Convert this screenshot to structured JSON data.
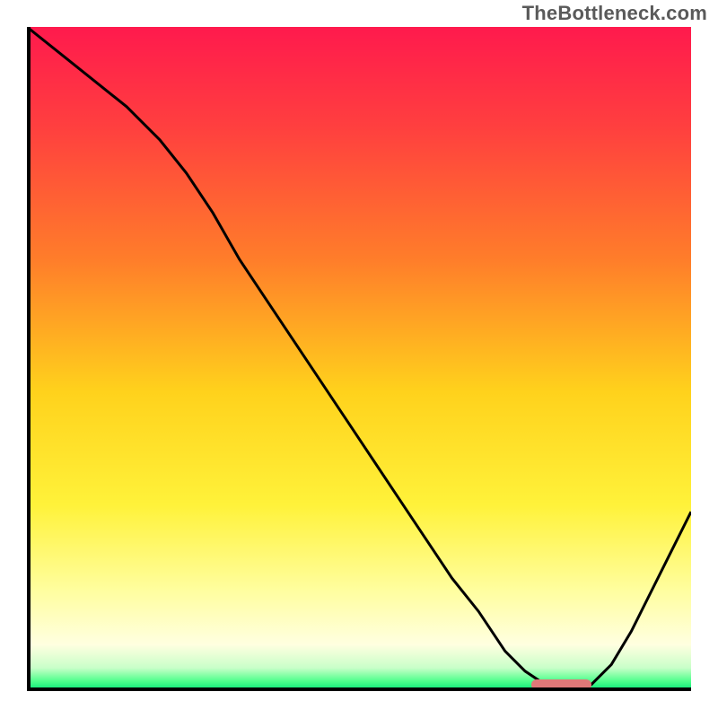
{
  "watermark": {
    "text": "TheBottleneck.com"
  },
  "chart_data": {
    "type": "line",
    "title": "",
    "xlabel": "",
    "ylabel": "",
    "xlim": [
      0,
      100
    ],
    "ylim": [
      0,
      100
    ],
    "grid": false,
    "legend": false,
    "background": {
      "type": "vertical_gradient",
      "stops": [
        {
          "pos": 0.0,
          "color": "#ff1a4d"
        },
        {
          "pos": 0.15,
          "color": "#ff3f3f"
        },
        {
          "pos": 0.35,
          "color": "#ff7d2a"
        },
        {
          "pos": 0.55,
          "color": "#ffd21c"
        },
        {
          "pos": 0.72,
          "color": "#fff23a"
        },
        {
          "pos": 0.85,
          "color": "#fffea0"
        },
        {
          "pos": 0.93,
          "color": "#ffffe0"
        },
        {
          "pos": 0.965,
          "color": "#c9ffc9"
        },
        {
          "pos": 0.985,
          "color": "#4fff8c"
        },
        {
          "pos": 1.0,
          "color": "#00e676"
        }
      ]
    },
    "series": [
      {
        "name": "bottleneck-curve",
        "color": "#000000",
        "x": [
          0,
          5,
          10,
          15,
          20,
          24,
          28,
          32,
          36,
          40,
          44,
          48,
          52,
          56,
          60,
          64,
          68,
          72,
          75,
          78,
          82,
          85,
          88,
          91,
          94,
          97,
          100
        ],
        "y": [
          100,
          96,
          92,
          88,
          83,
          78,
          72,
          65,
          59,
          53,
          47,
          41,
          35,
          29,
          23,
          17,
          12,
          6,
          3,
          1,
          1,
          1,
          4,
          9,
          15,
          21,
          27
        ]
      }
    ],
    "markers": [
      {
        "name": "optimal-range",
        "shape": "pill",
        "color": "#e07878",
        "x_start": 76,
        "x_end": 85,
        "y": 1
      }
    ]
  }
}
